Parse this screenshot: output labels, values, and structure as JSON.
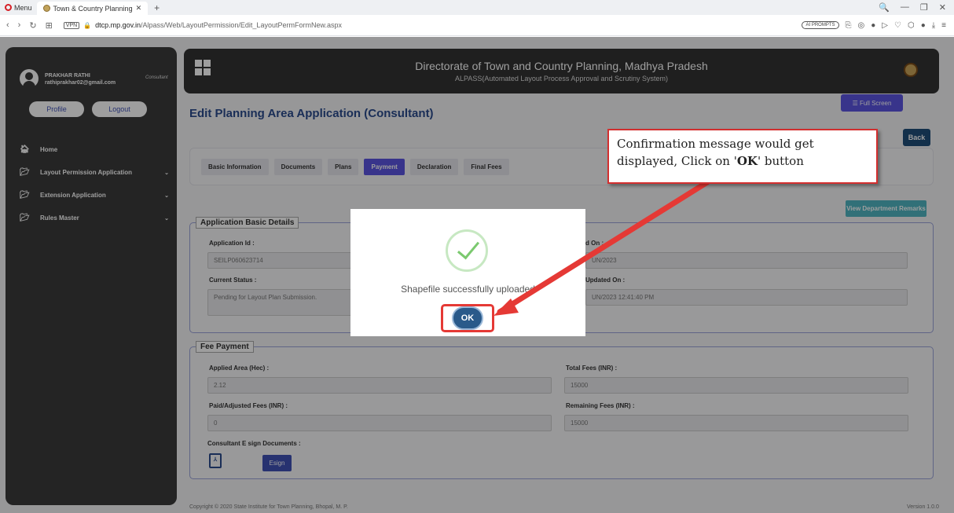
{
  "browser": {
    "menu_label": "Menu",
    "tab_title": "Town & Country Planning",
    "tab_close": "✕",
    "new_tab": "+",
    "window_controls": [
      "🔍",
      "—",
      "❐",
      "✕"
    ],
    "vpn_label": "VPN",
    "url_domain": "dtcp.mp.gov.in",
    "url_path": "/Alpass/Web/LayoutPermission/Edit_LayoutPermFormNew.aspx",
    "ai_prompts": "AI PROMPTS"
  },
  "sidebar": {
    "user_name": "PRAKHAR RATHI",
    "user_email": "rathiprakhar02@gmail.com",
    "role": "Consultant",
    "profile_label": "Profile",
    "logout_label": "Logout",
    "items": [
      {
        "label": "Home",
        "icon": "home-icon"
      },
      {
        "label": "Layout Permission Application",
        "icon": "folder-icon"
      },
      {
        "label": "Extension Application",
        "icon": "folder-icon"
      },
      {
        "label": "Rules Master",
        "icon": "folder-icon"
      }
    ]
  },
  "header": {
    "title": "Directorate of Town and Country Planning, Madhya Pradesh",
    "subtitle": "ALPASS(Automated Layout Process Approval and Scrutiny System)"
  },
  "main": {
    "page_title": "Edit Planning Area Application (Consultant)",
    "fullscreen_label": "Full Screen",
    "back_label": "Back",
    "tabs": [
      "Basic Information",
      "Documents",
      "Plans",
      "Payment",
      "Declaration",
      "Final Fees"
    ],
    "active_tab": "Payment",
    "remarks_label": "View Department Remarks"
  },
  "basic_details": {
    "legend": "Application Basic Details",
    "app_id_label": "Application Id :",
    "app_id_value": "SEILP060623714",
    "submitted_label_partial": "d On :",
    "submitted_value_partial": "UN/2023",
    "status_label": "Current Status :",
    "status_value": "Pending for Layout Plan Submission.",
    "updated_label_partial": "Updated On :",
    "updated_value_partial": "UN/2023 12:41:40 PM"
  },
  "fee_payment": {
    "legend": "Fee Payment",
    "applied_area_label": "Applied Area (Hec) :",
    "applied_area_value": "2.12",
    "total_fees_label": "Total Fees (INR) :",
    "total_fees_value": "15000",
    "paid_label": "Paid/Adjusted Fees (INR) :",
    "paid_value": "0",
    "remaining_label": "Remaining Fees (INR) :",
    "remaining_value": "15000",
    "esign_docs_label": "Consultant E sign Documents :",
    "esign_label": "Esign"
  },
  "modal": {
    "message": "Shapefile successfully uploaded",
    "ok_label": "OK"
  },
  "callout": {
    "text_before": "Confirmation message would get displayed, Click on '",
    "text_bold": "OK",
    "text_after": "' button"
  },
  "footer": {
    "copyright": "Copyright © 2020 State Institute for Town Planning, Bhopal, M. P.",
    "version": "Version 1.0.0"
  },
  "colors": {
    "accent": "#5b54e0",
    "header_bg": "#333333",
    "highlight": "#e53935",
    "title_blue": "#2a4b8d"
  }
}
